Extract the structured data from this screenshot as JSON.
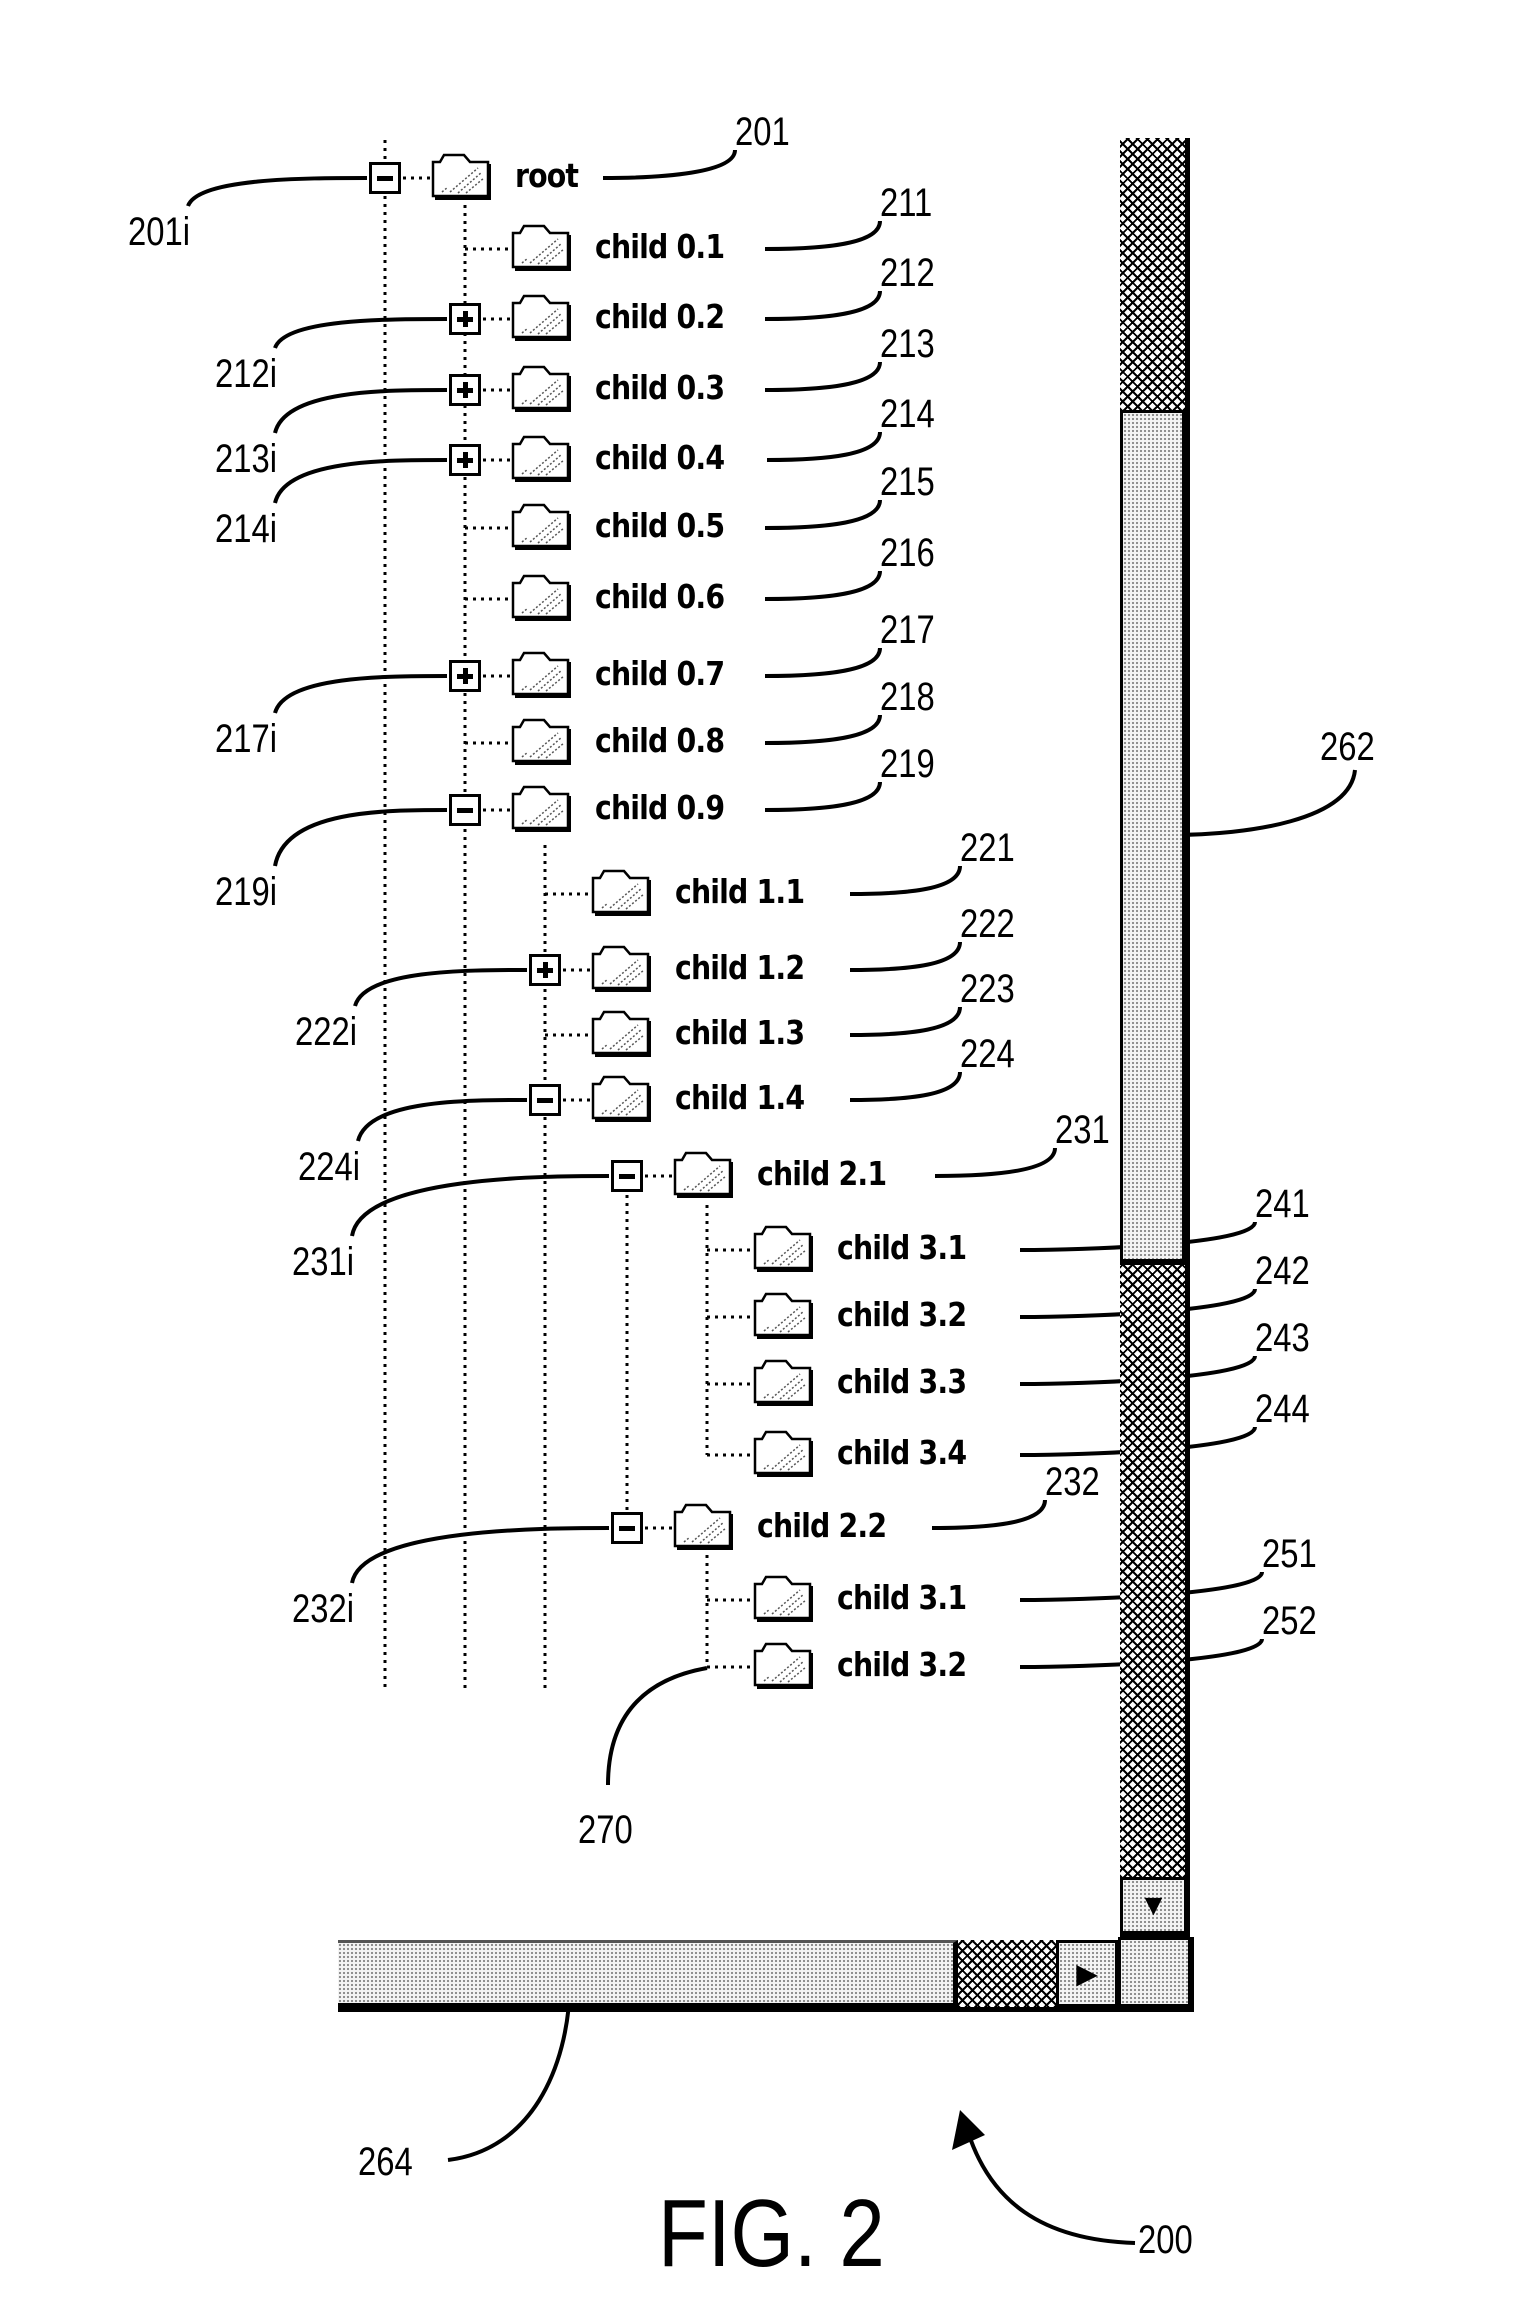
{
  "figure": {
    "title": "FIG. 2",
    "reference": "200"
  },
  "tree": {
    "nodes": [
      {
        "label": "root",
        "ref": "201",
        "toggle": "collapse",
        "toggle_ref": "201i",
        "level": 0
      },
      {
        "label": "child 0.1",
        "ref": "211",
        "toggle": null,
        "level": 1
      },
      {
        "label": "child 0.2",
        "ref": "212",
        "toggle": "expand",
        "toggle_ref": "212i",
        "level": 1
      },
      {
        "label": "child 0.3",
        "ref": "213",
        "toggle": "expand",
        "toggle_ref": "213i",
        "level": 1
      },
      {
        "label": "child 0.4",
        "ref": "214",
        "toggle": "expand",
        "toggle_ref": "214i",
        "level": 1
      },
      {
        "label": "child 0.5",
        "ref": "215",
        "toggle": null,
        "level": 1
      },
      {
        "label": "child 0.6",
        "ref": "216",
        "toggle": null,
        "level": 1
      },
      {
        "label": "child 0.7",
        "ref": "217",
        "toggle": "expand",
        "toggle_ref": "217i",
        "level": 1
      },
      {
        "label": "child 0.8",
        "ref": "218",
        "toggle": null,
        "level": 1
      },
      {
        "label": "child 0.9",
        "ref": "219",
        "toggle": "collapse",
        "toggle_ref": "219i",
        "level": 1
      },
      {
        "label": "child 1.1",
        "ref": "221",
        "toggle": null,
        "level": 2
      },
      {
        "label": "child 1.2",
        "ref": "222",
        "toggle": "expand",
        "toggle_ref": "222i",
        "level": 2
      },
      {
        "label": "child 1.3",
        "ref": "223",
        "toggle": null,
        "level": 2
      },
      {
        "label": "child 1.4",
        "ref": "224",
        "toggle": "collapse",
        "toggle_ref": "224i",
        "level": 2
      },
      {
        "label": "child 2.1",
        "ref": "231",
        "toggle": "collapse",
        "toggle_ref": "231i",
        "level": 3
      },
      {
        "label": "child 3.1",
        "ref": "241",
        "toggle": null,
        "level": 4
      },
      {
        "label": "child 3.2",
        "ref": "242",
        "toggle": null,
        "level": 4
      },
      {
        "label": "child 3.3",
        "ref": "243",
        "toggle": null,
        "level": 4
      },
      {
        "label": "child 3.4",
        "ref": "244",
        "toggle": null,
        "level": 4
      },
      {
        "label": "child 2.2",
        "ref": "232",
        "toggle": "collapse",
        "toggle_ref": "232i",
        "level": 3
      },
      {
        "label": "child 3.1",
        "ref": "251",
        "toggle": null,
        "level": 4
      },
      {
        "label": "child 3.2",
        "ref": "252",
        "toggle": null,
        "level": 4
      }
    ],
    "connector_ref": "270"
  },
  "scrollbars": {
    "vertical": {
      "ref": "262",
      "down_arrow": "▼"
    },
    "horizontal": {
      "ref": "264",
      "right_arrow": "▶"
    }
  }
}
